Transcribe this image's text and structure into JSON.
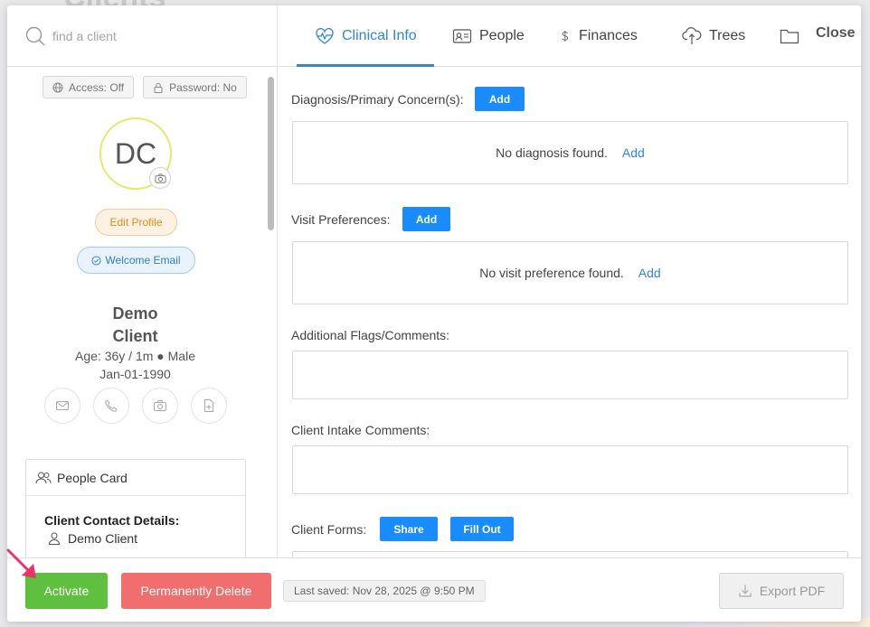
{
  "backdrop": {
    "title": "Clients"
  },
  "search": {
    "placeholder": "find a client"
  },
  "profile": {
    "access_label": "Access: Off",
    "password_label": "Password: No",
    "initials": "DC",
    "edit_profile_label": "Edit Profile",
    "welcome_email_label": "Welcome Email",
    "first_name": "Demo",
    "last_name": "Client",
    "age_gender": "Age: 36y / 1m ● Male",
    "dob": "Jan-01-1990",
    "contact_icons": [
      "mail-icon",
      "phone-icon",
      "camera-icon",
      "document-icon"
    ]
  },
  "people_card": {
    "title": "People Card",
    "section_title": "Client Contact Details:",
    "contact_name": "Demo Client"
  },
  "tabs": [
    {
      "label": "Clinical Info",
      "icon": "heart-pulse-icon",
      "active": true
    },
    {
      "label": "People",
      "icon": "id-card-icon",
      "active": false
    },
    {
      "label": "Finances",
      "icon": "dollar-icon",
      "active": false
    },
    {
      "label": "Trees",
      "icon": "cloud-tree-icon",
      "active": false
    }
  ],
  "close_label": "Close",
  "clinical": {
    "diagnosis_label": "Diagnosis/Primary Concern(s):",
    "diagnosis_add": "Add",
    "diagnosis_empty": "No diagnosis found.",
    "diagnosis_link": "Add",
    "visit_label": "Visit Preferences:",
    "visit_add": "Add",
    "visit_empty": "No visit preference found.",
    "visit_link": "Add",
    "flags_label": "Additional Flags/Comments:",
    "intake_label": "Client Intake Comments:",
    "forms_label": "Client Forms:",
    "forms_share": "Share",
    "forms_fill": "Fill Out"
  },
  "footer": {
    "activate_label": "Activate",
    "delete_label": "Permanently Delete",
    "last_saved": "Last saved: Nov 28, 2025 @ 9:50 PM",
    "export_label": "Export PDF"
  },
  "colors": {
    "accent": "#2f86dc",
    "primary_button": "#1a8cff",
    "activate": "#5fbf3e",
    "delete": "#f06e6e",
    "avatar_ring": "#e2ea6a",
    "annotation_arrow": "#e8336d"
  }
}
